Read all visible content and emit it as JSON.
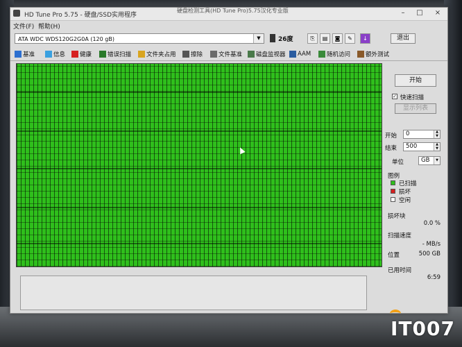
{
  "window": {
    "title": "HD Tune Pro 5.75 - 硬盘/SSD实用程序",
    "external_title": "硬盘检测工具(HD Tune Pro)5.75汉化专业版"
  },
  "menu": [
    "文件(F)",
    "帮助(H)"
  ],
  "drive": {
    "selected": "ATA     WDC WDS120G2G0A (120 gB)",
    "temperature": "26度",
    "exit_label": "退出"
  },
  "tabs": [
    {
      "label": "基准",
      "icon": "benchmark-icon",
      "color": "#2c6fd0"
    },
    {
      "label": "信息",
      "icon": "info-icon",
      "color": "#3aa0e0"
    },
    {
      "label": "健康",
      "icon": "health-cross-icon",
      "color": "#d62020"
    },
    {
      "label": "错误扫描",
      "icon": "magnifier-icon",
      "color": "#2a7a2a"
    },
    {
      "label": "文件夹占用",
      "icon": "folder-icon",
      "color": "#d9a520"
    },
    {
      "label": "擦除",
      "icon": "eraser-icon",
      "color": "#555555"
    },
    {
      "label": "文件基准",
      "icon": "file-benchmark-icon",
      "color": "#6a6a6a"
    },
    {
      "label": "磁盘监视器",
      "icon": "monitor-icon",
      "color": "#4a7a4a"
    },
    {
      "label": "AAM",
      "icon": "speaker-icon",
      "color": "#2a5ca0"
    },
    {
      "label": "随机访问",
      "icon": "random-access-icon",
      "color": "#3a8a3a"
    },
    {
      "label": "额外测试",
      "icon": "extra-tests-icon",
      "color": "#8a5a2a"
    }
  ],
  "panel": {
    "start_label": "开始",
    "quick_scan_label": "快速扫描",
    "quick_scan_checked": true,
    "disabled_button_label": "显示列表",
    "start_field_label": "开始",
    "start_value": "0",
    "end_field_label": "结束",
    "end_value": "500",
    "unit_label": "单位",
    "unit_value": "GB",
    "legend_title": "图例",
    "legend": [
      {
        "label": "已扫描",
        "color": "#2fbf1c"
      },
      {
        "label": "损坏",
        "color": "#d62020"
      },
      {
        "label": "空闲",
        "color": "#ffffff"
      }
    ],
    "damaged_blocks_label": "损坏块",
    "damaged_blocks_value": "0.0 %",
    "scan_speed_label": "扫描速度",
    "scan_speed_value": "- MB/s",
    "position_label": "位置",
    "position_value": "500 GB",
    "elapsed_label": "已用时间",
    "elapsed_value": "6:59"
  },
  "watermark": "IT007"
}
